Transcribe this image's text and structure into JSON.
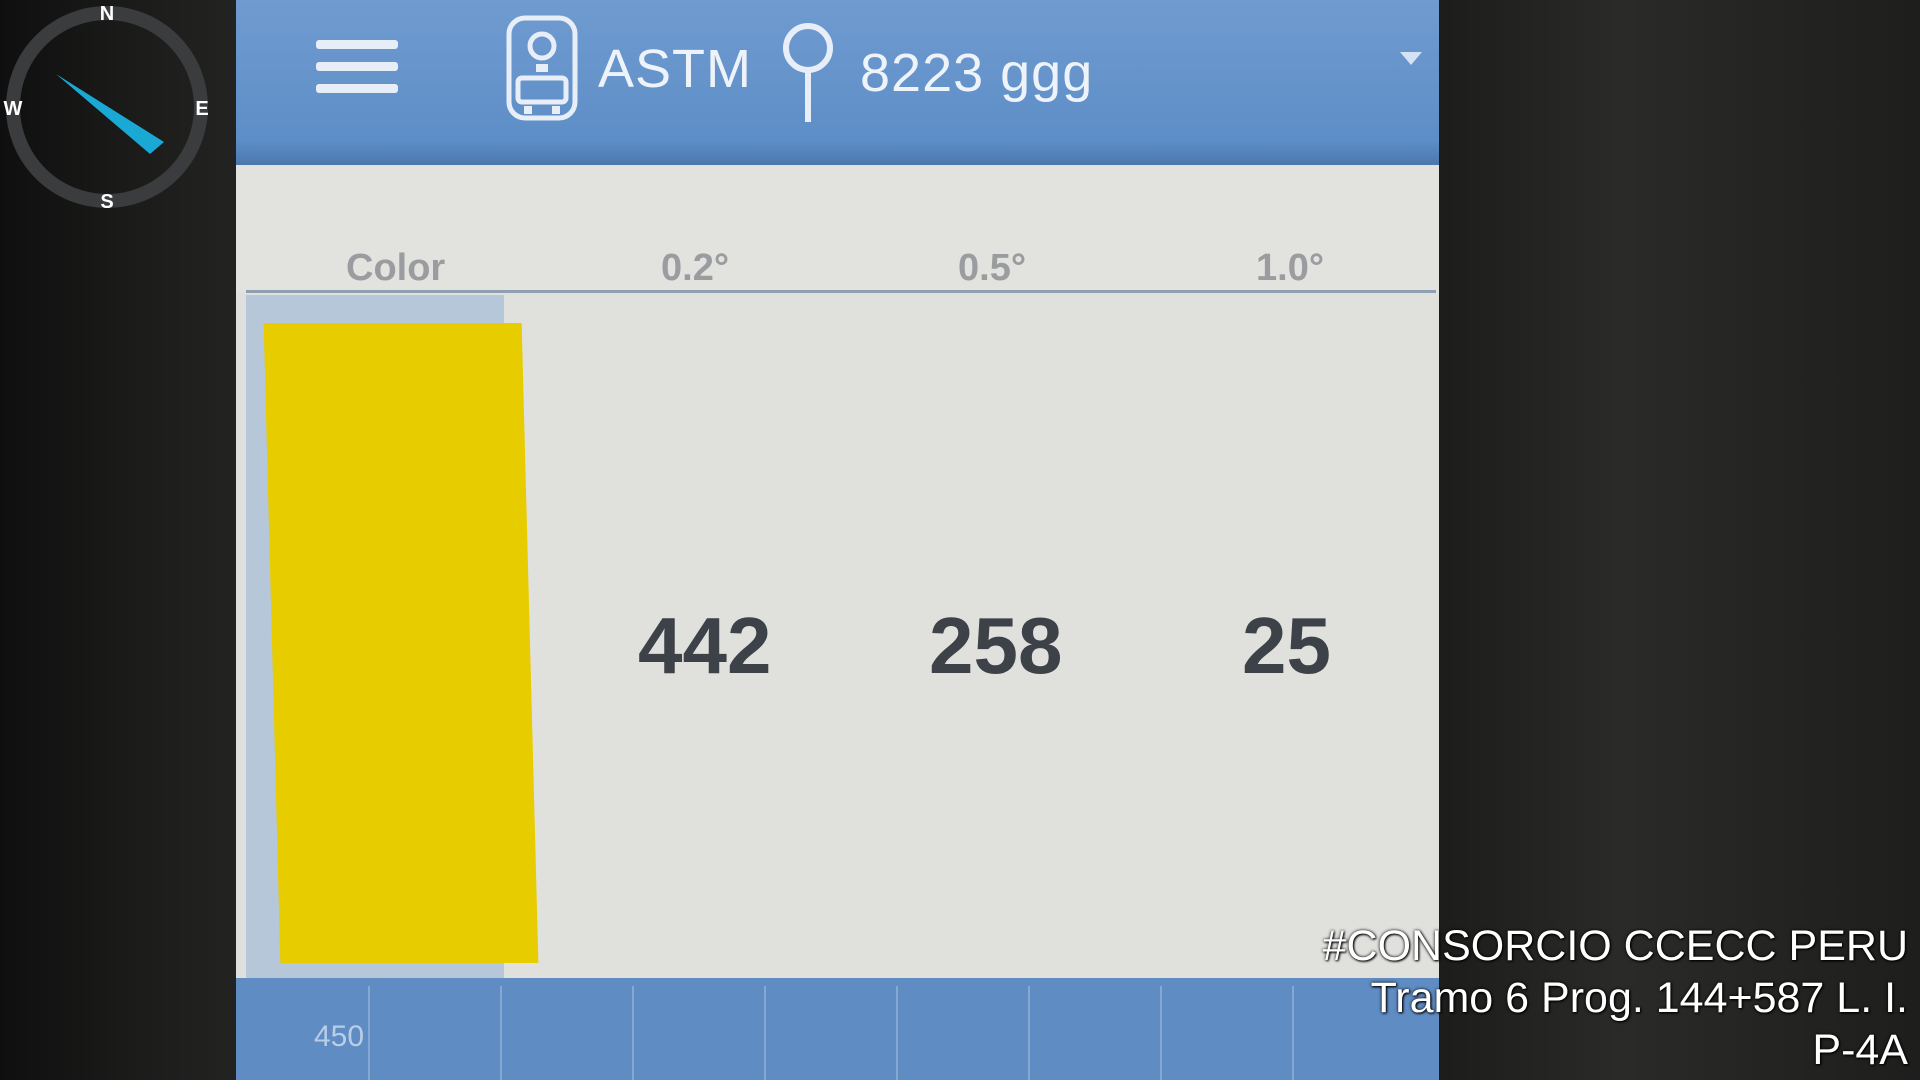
{
  "compass": {
    "north": "N",
    "east": "E",
    "south": "S",
    "west": "W",
    "needle_color": "#1aa8d4"
  },
  "appbar": {
    "standard": "ASTM",
    "location": "8223 ggg",
    "icons": [
      "menu-icon",
      "retroreflectometer-icon",
      "location-pin-icon",
      "dropdown-caret-icon"
    ]
  },
  "table": {
    "headers": [
      "Color",
      "0.2°",
      "0.5°",
      "1.0°"
    ],
    "row": {
      "color_hex": "#e7cc00",
      "values": [
        "442",
        "258",
        "25"
      ]
    }
  },
  "graph": {
    "axis_label": "450"
  },
  "watermark": {
    "line1": "#CONSORCIO CCECC PERU",
    "line2": "Tramo 6 Prog. 144+587 L. I.",
    "line3": "P-4A"
  }
}
